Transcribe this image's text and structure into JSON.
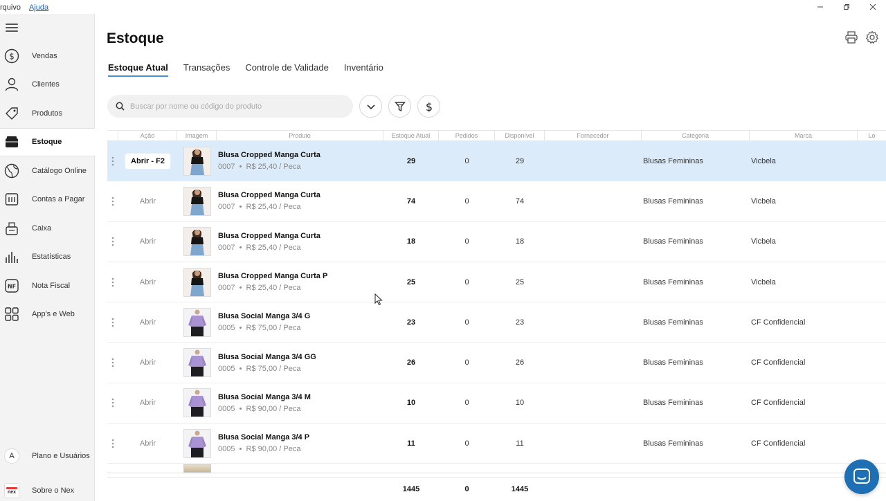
{
  "menu": {
    "items": [
      "rquivo",
      "Ajuda"
    ]
  },
  "sidebar": {
    "items": [
      {
        "label": "Vendas",
        "icon": "dollar-circle-icon"
      },
      {
        "label": "Clientes",
        "icon": "user-icon"
      },
      {
        "label": "Produtos",
        "icon": "tag-icon"
      },
      {
        "label": "Estoque",
        "icon": "box-icon"
      },
      {
        "label": "Catálogo Online",
        "icon": "globe-icon"
      },
      {
        "label": "Contas a Pagar",
        "icon": "calendar-icon"
      },
      {
        "label": "Caixa",
        "icon": "cash-register-icon"
      },
      {
        "label": "Estatísticas",
        "icon": "bar-chart-icon"
      },
      {
        "label": "Nota Fiscal",
        "icon": "nf-icon"
      },
      {
        "label": "App's e Web",
        "icon": "grid-icon"
      }
    ],
    "bottom": [
      {
        "label": "Plano e Usuários",
        "avatar": "A"
      },
      {
        "label": "Sobre o Nex",
        "logo": "nex"
      }
    ]
  },
  "page": {
    "title": "Estoque"
  },
  "tabs": [
    {
      "label": "Estoque Atual",
      "active": true
    },
    {
      "label": "Transações"
    },
    {
      "label": "Controle de Validade"
    },
    {
      "label": "Inventário"
    }
  ],
  "search": {
    "placeholder": "Buscar por nome ou código do produto"
  },
  "table": {
    "columns": [
      "Ação",
      "Imagem",
      "Produto",
      "Estoque Atual",
      "Pedidos",
      "Disponível",
      "Fornecedor",
      "Categoria",
      "Marca",
      "Lo"
    ],
    "rows": [
      {
        "action": "Abrir - F2",
        "name": "Blusa Cropped Manga Curta",
        "meta": "0007  •  R$ 25,40 / Peca",
        "estoque": "29",
        "pedidos": "0",
        "disponivel": "29",
        "fornecedor": "",
        "categoria": "Blusas Femininas",
        "marca": "Vicbela",
        "thumb": "dark"
      },
      {
        "action": "Abrir",
        "name": "Blusa Cropped Manga Curta",
        "meta": "0007  •  R$ 25,40 / Peca",
        "estoque": "74",
        "pedidos": "0",
        "disponivel": "74",
        "fornecedor": "",
        "categoria": "Blusas Femininas",
        "marca": "Vicbela",
        "thumb": "dark"
      },
      {
        "action": "Abrir",
        "name": "Blusa Cropped Manga Curta",
        "meta": "0007  •  R$ 25,40 / Peca",
        "estoque": "18",
        "pedidos": "0",
        "disponivel": "18",
        "fornecedor": "",
        "categoria": "Blusas Femininas",
        "marca": "Vicbela",
        "thumb": "dark"
      },
      {
        "action": "Abrir",
        "name": "Blusa Cropped Manga Curta P",
        "meta": "0007  •  R$ 25,40 / Peca",
        "estoque": "25",
        "pedidos": "0",
        "disponivel": "25",
        "fornecedor": "",
        "categoria": "Blusas Femininas",
        "marca": "Vicbela",
        "thumb": "dark"
      },
      {
        "action": "Abrir",
        "name": "Blusa Social Manga 3/4 G",
        "meta": "0005  •  R$ 75,00 / Peca",
        "estoque": "23",
        "pedidos": "0",
        "disponivel": "23",
        "fornecedor": "",
        "categoria": "Blusas Femininas",
        "marca": "CF Confidencial",
        "thumb": "lilac"
      },
      {
        "action": "Abrir",
        "name": "Blusa Social Manga 3/4 GG",
        "meta": "0005  •  R$ 75,00 / Peca",
        "estoque": "26",
        "pedidos": "0",
        "disponivel": "26",
        "fornecedor": "",
        "categoria": "Blusas Femininas",
        "marca": "CF Confidencial",
        "thumb": "lilac"
      },
      {
        "action": "Abrir",
        "name": "Blusa Social Manga 3/4 M",
        "meta": "0005  •  R$ 90,00 / Peca",
        "estoque": "10",
        "pedidos": "0",
        "disponivel": "10",
        "fornecedor": "",
        "categoria": "Blusas Femininas",
        "marca": "CF Confidencial",
        "thumb": "lilac"
      },
      {
        "action": "Abrir",
        "name": "Blusa Social Manga 3/4 P",
        "meta": "0005  •  R$ 90,00 / Peca",
        "estoque": "11",
        "pedidos": "0",
        "disponivel": "11",
        "fornecedor": "",
        "categoria": "Blusas Femininas",
        "marca": "CF Confidencial",
        "thumb": "lilac"
      }
    ],
    "totals": {
      "estoque": "1445",
      "pedidos": "0",
      "disponivel": "1445"
    }
  },
  "colors": {
    "accent": "#4a90d9",
    "selected_row": "#dcebf9",
    "chat": "#1f6fb4"
  }
}
